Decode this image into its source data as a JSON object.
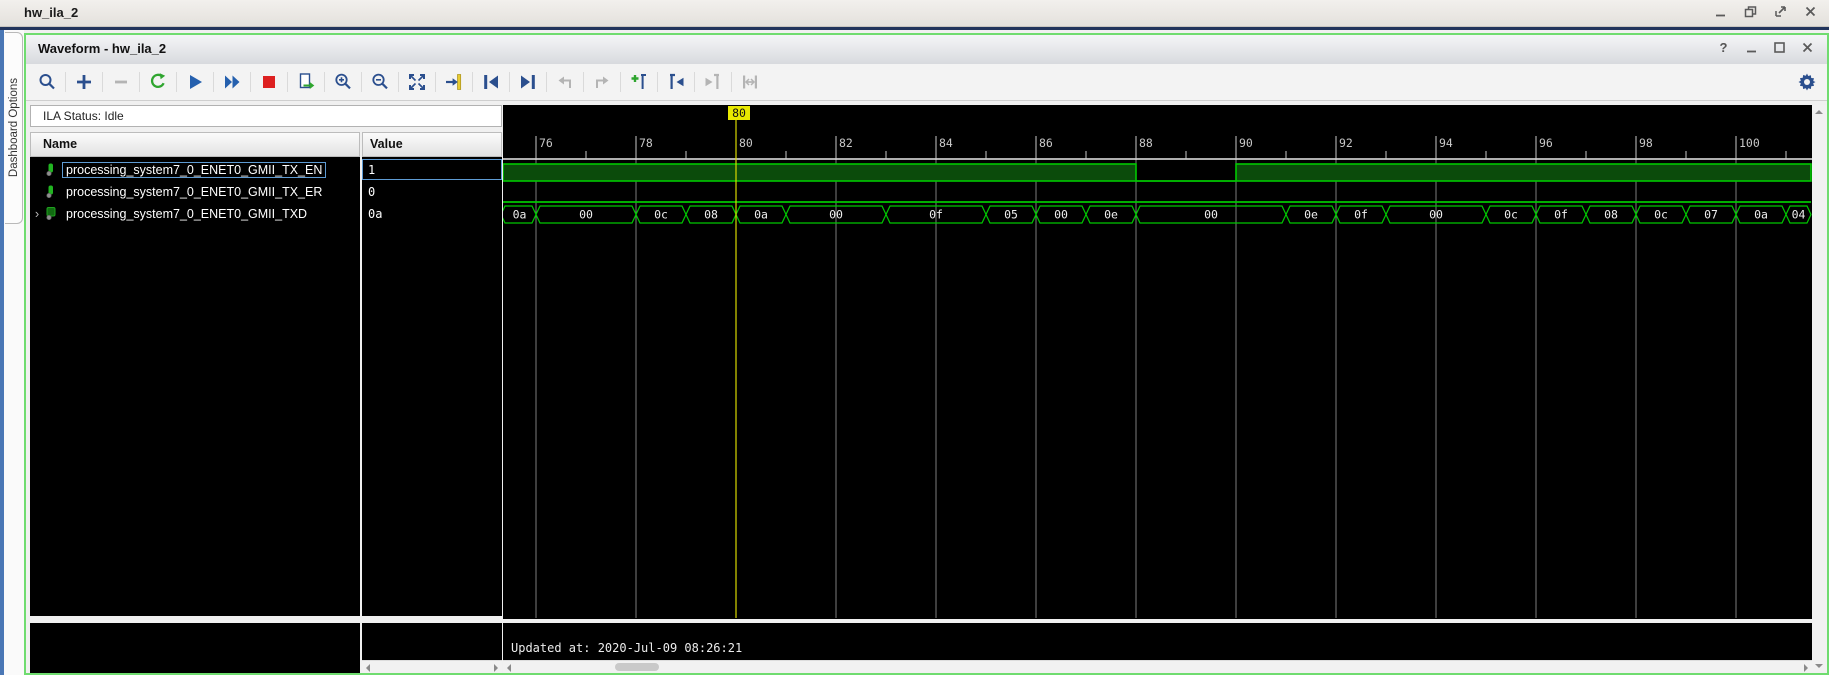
{
  "window": {
    "title": "hw_ila_2",
    "controls": [
      {
        "name": "minimize",
        "glyph": "minimize"
      },
      {
        "name": "restore",
        "glyph": "restore"
      },
      {
        "name": "float",
        "glyph": "float"
      },
      {
        "name": "close",
        "glyph": "close"
      }
    ]
  },
  "sidebar": {
    "tab": "Dashboard Options"
  },
  "panel": {
    "title": "Waveform - hw_ila_2",
    "controls": [
      {
        "name": "help",
        "glyph": "help"
      },
      {
        "name": "minimize",
        "glyph": "minimize"
      },
      {
        "name": "maximize",
        "glyph": "maximize"
      },
      {
        "name": "close",
        "glyph": "close"
      }
    ]
  },
  "toolbar": {
    "icons": [
      {
        "name": "find",
        "enabled": true
      },
      {
        "name": "add",
        "enabled": true
      },
      {
        "name": "remove",
        "enabled": false
      },
      {
        "name": "restart-trigger",
        "enabled": true
      },
      {
        "name": "run-trigger",
        "enabled": true
      },
      {
        "name": "run-trigger-immediate",
        "enabled": true
      },
      {
        "name": "stop-trigger",
        "enabled": true
      },
      {
        "name": "export-ila-data",
        "enabled": true
      },
      {
        "name": "zoom-in",
        "enabled": true
      },
      {
        "name": "zoom-out",
        "enabled": true
      },
      {
        "name": "zoom-fit",
        "enabled": true
      },
      {
        "name": "goto-trigger",
        "enabled": true
      },
      {
        "name": "goto-previous-transition",
        "enabled": true
      },
      {
        "name": "goto-next-transition",
        "enabled": true
      },
      {
        "name": "swap-previous",
        "enabled": false
      },
      {
        "name": "swap-next",
        "enabled": false
      },
      {
        "name": "add-marker",
        "enabled": true
      },
      {
        "name": "goto-previous-marker",
        "enabled": true
      },
      {
        "name": "goto-next-marker",
        "enabled": false
      },
      {
        "name": "fit-markers",
        "enabled": false
      }
    ],
    "settings_icon": "gear"
  },
  "status": {
    "text": "ILA Status: Idle"
  },
  "table": {
    "columns": [
      "Name",
      "Value"
    ],
    "rows": [
      {
        "name": "processing_system7_0_ENET0_GMII_TX_EN",
        "value": "1",
        "type": "bit",
        "selected": true,
        "expandable": false
      },
      {
        "name": "processing_system7_0_ENET0_GMII_TX_ER",
        "value": "0",
        "type": "bit",
        "selected": false,
        "expandable": false
      },
      {
        "name": "processing_system7_0_ENET0_GMII_TXD",
        "value": "0a",
        "type": "bus",
        "selected": false,
        "expandable": true
      }
    ]
  },
  "footer": {
    "updated": "Updated at: 2020-Jul-09 08:26:21"
  },
  "chart_data": {
    "type": "waveform",
    "x_axis": {
      "label_ticks": [
        76,
        78,
        80,
        82,
        84,
        86,
        88,
        90,
        92,
        94,
        96,
        98,
        100
      ],
      "minor_tick_step": 1,
      "visible_range": [
        75.3,
        101.5
      ]
    },
    "marker": {
      "time": 80,
      "label": "80",
      "color": "#e8e800"
    },
    "signals": [
      {
        "name": "processing_system7_0_ENET0_GMII_TX_EN",
        "type": "bit",
        "wave": [
          {
            "from": 75.3,
            "to": 88,
            "value": "1"
          },
          {
            "from": 88,
            "to": 90,
            "value": "0"
          },
          {
            "from": 90,
            "to": 101.5,
            "value": "1"
          }
        ]
      },
      {
        "name": "processing_system7_0_ENET0_GMII_TX_ER",
        "type": "bit",
        "wave": [
          {
            "from": 75.3,
            "to": 101.5,
            "value": "0"
          }
        ]
      },
      {
        "name": "processing_system7_0_ENET0_GMII_TXD",
        "type": "bus",
        "wave": [
          {
            "from": 75.3,
            "to": 76,
            "value": "0a"
          },
          {
            "from": 76,
            "to": 78,
            "value": "00"
          },
          {
            "from": 78,
            "to": 79,
            "value": "0c"
          },
          {
            "from": 79,
            "to": 80,
            "value": "08"
          },
          {
            "from": 80,
            "to": 81,
            "value": "0a"
          },
          {
            "from": 81,
            "to": 83,
            "value": "00"
          },
          {
            "from": 83,
            "to": 85,
            "value": "0f"
          },
          {
            "from": 85,
            "to": 86,
            "value": "05"
          },
          {
            "from": 86,
            "to": 87,
            "value": "00"
          },
          {
            "from": 87,
            "to": 88,
            "value": "0e"
          },
          {
            "from": 88,
            "to": 91,
            "value": "00"
          },
          {
            "from": 91,
            "to": 92,
            "value": "0e"
          },
          {
            "from": 92,
            "to": 93,
            "value": "0f"
          },
          {
            "from": 93,
            "to": 95,
            "value": "00"
          },
          {
            "from": 95,
            "to": 96,
            "value": "0c"
          },
          {
            "from": 96,
            "to": 97,
            "value": "0f"
          },
          {
            "from": 97,
            "to": 98,
            "value": "08"
          },
          {
            "from": 98,
            "to": 99,
            "value": "0c"
          },
          {
            "from": 99,
            "to": 100,
            "value": "07"
          },
          {
            "from": 100,
            "to": 101,
            "value": "0a"
          },
          {
            "from": 101,
            "to": 101.5,
            "value": "04"
          }
        ]
      }
    ],
    "colors": {
      "signal": "#00c800",
      "high_fill": "#0b4b0b",
      "grid": "#7d7d7d",
      "ruler_text": "#c8c8c8",
      "background": "#000000",
      "marker": "#d8d800"
    }
  }
}
